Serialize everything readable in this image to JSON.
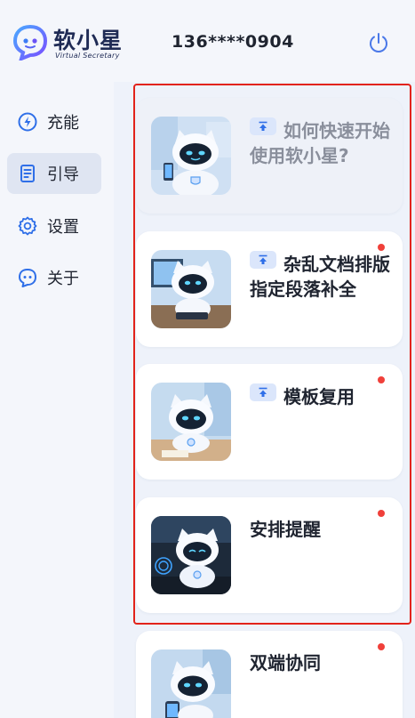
{
  "header": {
    "logo_text": "软小星",
    "logo_subtitle": "Virtual Secretary",
    "phone": "136****0904",
    "power_icon": "power-icon"
  },
  "sidebar": {
    "items": [
      {
        "label": "充能",
        "icon": "lightning-icon"
      },
      {
        "label": "引导",
        "icon": "document-icon",
        "active": true
      },
      {
        "label": "设置",
        "icon": "gear-icon"
      },
      {
        "label": "关于",
        "icon": "robot-icon"
      }
    ]
  },
  "cards": [
    {
      "title": "如何快速开始使用软小星?",
      "pinned": true,
      "unread": false
    },
    {
      "title": "杂乱文档排版指定段落补全",
      "pinned": true,
      "unread": true
    },
    {
      "title": "模板复用",
      "pinned": true,
      "unread": true
    },
    {
      "title": "安排提醒",
      "pinned": false,
      "unread": true
    },
    {
      "title": "双端协同",
      "pinned": false,
      "unread": true
    }
  ],
  "colors": {
    "accent": "#2f6fe8",
    "unread_dot": "#f0403a",
    "highlight_border": "#e2231a"
  }
}
